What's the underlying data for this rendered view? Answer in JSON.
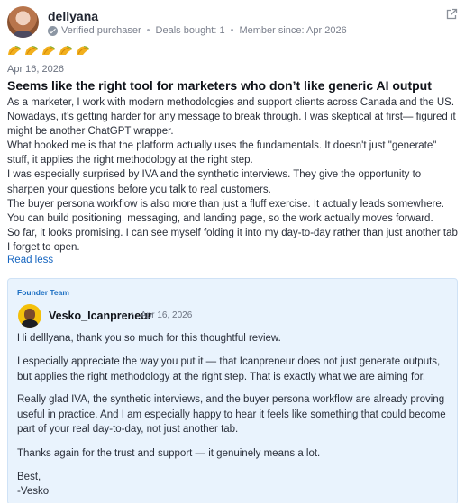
{
  "review": {
    "username": "dellyana",
    "verified": "Verified purchaser",
    "deals": "Deals bought: 1",
    "member_since": "Member since: Apr 2026",
    "rating": 5,
    "date": "Apr 16, 2026",
    "title": "Seems like the right tool for marketers who don’t like generic AI output",
    "body": [
      "As a marketer, I work with modern methodologies and support clients across Canada and the US. Nowadays, it’s getting harder for any message to break through. I was skeptical at first— figured it might be another ChatGPT wrapper.",
      "What hooked me is that the platform actually uses the fundamentals. It doesn't just \"generate\" stuff, it applies the right methodology at the right step.",
      "I was especially surprised by IVA and the synthetic interviews. They give the opportunity to sharpen your questions before you talk to real customers.",
      "The buyer persona workflow is also more than just a fluff exercise. It actually leads somewhere. You can build positioning, messaging, and landing page, so the work actually moves forward.",
      "So far, it looks promising. I can see myself folding it into my day-to-day rather than just another tab I forget to open."
    ],
    "read_less": "Read less",
    "icons": {
      "external_link": "external-link-icon",
      "verified": "check-circle-icon",
      "rating": "taco-icon"
    },
    "colors": {
      "link": "#1565c0",
      "rating": "#f2b01e",
      "reply_bg": "#e9f3fd"
    }
  },
  "reply": {
    "tag": "Founder Team",
    "name": "Vesko_Icanpreneur",
    "dot": "•",
    "date": "Apr 16, 2026",
    "paragraphs": [
      "Hi delllyana, thank you so much for this thoughtful review.",
      "I especially appreciate the way you put it — that Icanpreneur does not just generate outputs, but applies the right methodology at the right step. That is exactly what we are aiming for.",
      "Really glad IVA, the synthetic interviews, and the buyer persona workflow are already proving useful in practice. And I am especially happy to hear it feels like something that could become part of your real day-to-day, not just another tab.",
      "Thanks again for the trust and support — it genuinely means a lot.",
      "Best,",
      "-Vesko"
    ]
  }
}
